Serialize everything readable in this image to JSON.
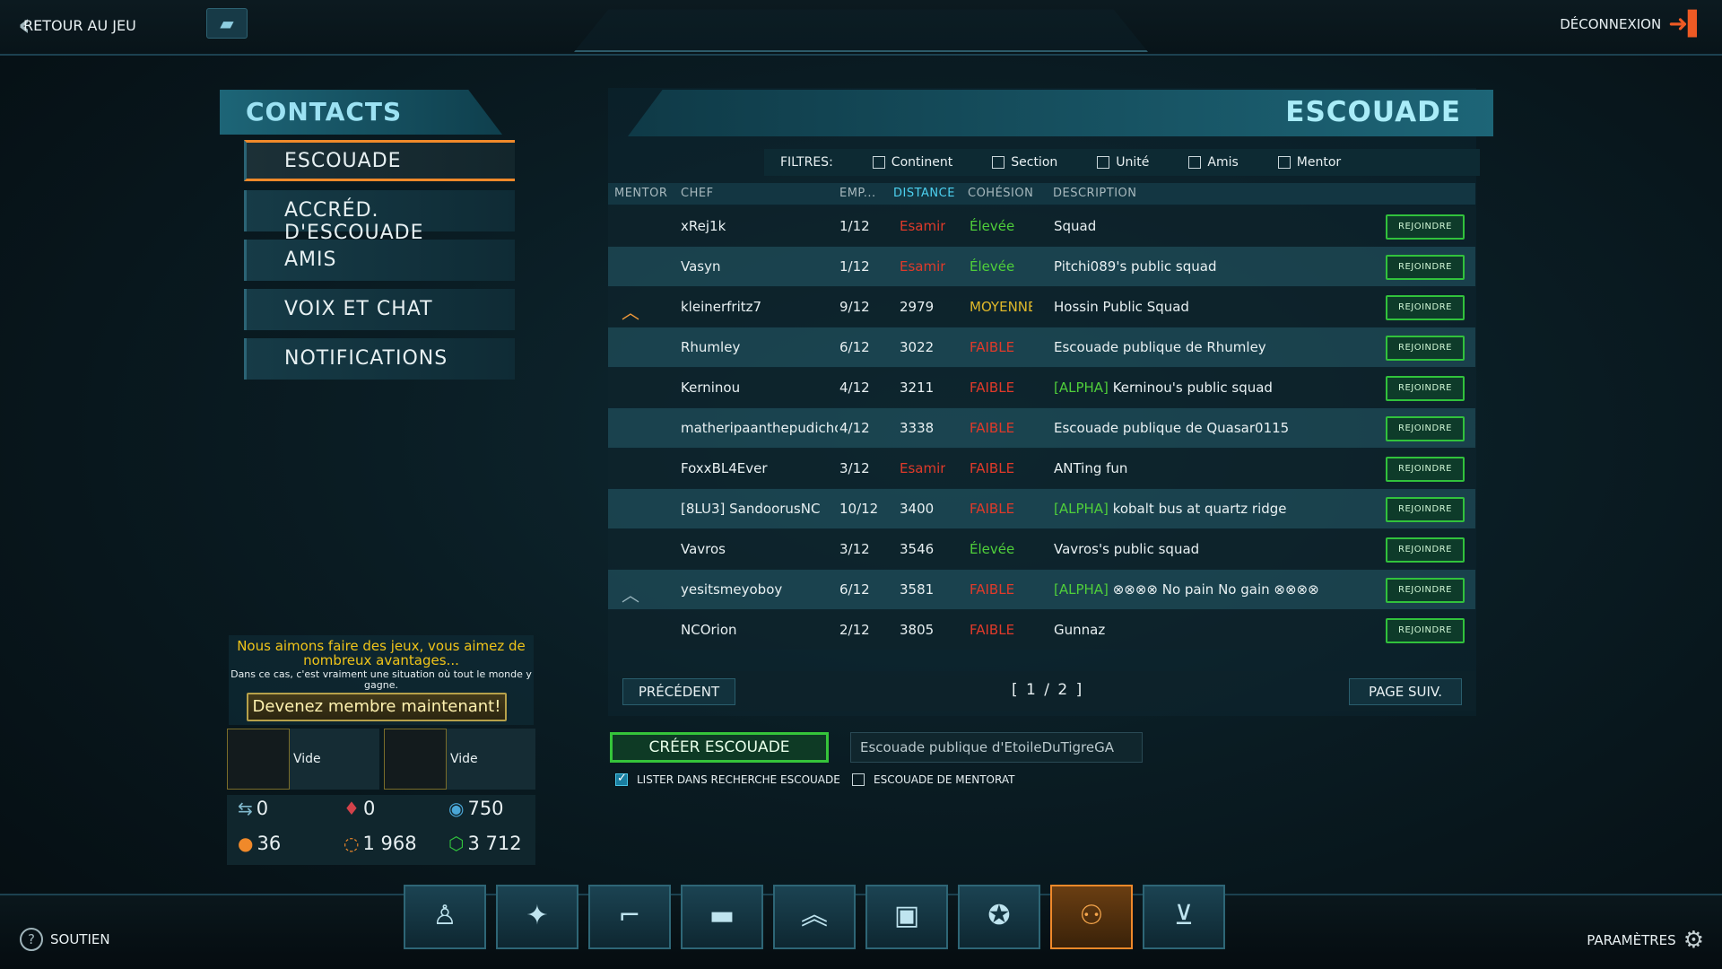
{
  "topbar": {
    "back_label": "RETOUR AU JEU",
    "logout_label": "DÉCONNEXION"
  },
  "sidebar": {
    "title": "CONTACTS",
    "items": [
      {
        "label": "ESCOUADE",
        "active": true
      },
      {
        "label": "ACCRÉD. D'ESCOUADE"
      },
      {
        "label": "AMIS"
      },
      {
        "label": "VOIX ET CHAT"
      },
      {
        "label": "NOTIFICATIONS"
      }
    ],
    "promo": {
      "headline": "Nous aimons faire des jeux, vous aimez de nombreux avantages...",
      "subtext": "Dans ce cas, c'est vraiment une situation où tout le monde y gagne.",
      "button": "Devenez membre maintenant!"
    },
    "slots": [
      {
        "label": "Vide"
      },
      {
        "label": "Vide"
      }
    ],
    "stats": {
      "s1": "0",
      "s2": "0",
      "s3": "750",
      "s4": "36",
      "s5": "1 968",
      "s6": "3 712"
    }
  },
  "main": {
    "title": "ESCOUADE",
    "filters": {
      "label": "FILTRES:",
      "items": [
        {
          "label": "Continent",
          "checked": false
        },
        {
          "label": "Section",
          "checked": false
        },
        {
          "label": "Unité",
          "checked": false
        },
        {
          "label": "Amis",
          "checked": false
        },
        {
          "label": "Mentor",
          "checked": false
        }
      ]
    },
    "columns": {
      "mentor": "MENTOR",
      "chef": "CHEF",
      "emp": "EMP...",
      "distance": "DISTANCE",
      "cohesion": "COHÉSION",
      "description": "DESCRIPTION"
    },
    "join_label": "REJOINDRE",
    "rows": [
      {
        "mentor": "",
        "chef": "xRej1k",
        "emp": "1/12",
        "distance": "Esamir",
        "cohesion": "Élevée",
        "tag": "",
        "desc": "Squad"
      },
      {
        "mentor": "",
        "chef": "Vasyn",
        "emp": "1/12",
        "distance": "Esamir",
        "cohesion": "Élevée",
        "tag": "",
        "desc": "Pitchi089's public squad"
      },
      {
        "mentor": "up-chevron",
        "chef": "kleinerfritz7",
        "emp": "9/12",
        "distance": "2979",
        "cohesion": "MOYENNE",
        "tag": "",
        "desc": "Hossin Public Squad"
      },
      {
        "mentor": "",
        "chef": "Rhumley",
        "emp": "6/12",
        "distance": "3022",
        "cohesion": "FAIBLE",
        "tag": "",
        "desc": "Escouade publique de Rhumley"
      },
      {
        "mentor": "",
        "chef": "Kerninou",
        "emp": "4/12",
        "distance": "3211",
        "cohesion": "FAIBLE",
        "tag": "[ALPHA]",
        "desc": "Kerninou's public squad"
      },
      {
        "mentor": "",
        "chef": "matheripaanthepudicho",
        "emp": "4/12",
        "distance": "3338",
        "cohesion": "FAIBLE",
        "tag": "",
        "desc": "Escouade publique de Quasar0115"
      },
      {
        "mentor": "",
        "chef": "FoxxBL4Ever",
        "emp": "3/12",
        "distance": "Esamir",
        "cohesion": "FAIBLE",
        "tag": "",
        "desc": "ANTing fun"
      },
      {
        "mentor": "",
        "chef": "[8LU3] SandoorusNC",
        "emp": "10/12",
        "distance": "3400",
        "cohesion": "FAIBLE",
        "tag": "[ALPHA]",
        "desc": "kobalt bus at quartz ridge"
      },
      {
        "mentor": "",
        "chef": "Vavros",
        "emp": "3/12",
        "distance": "3546",
        "cohesion": "Élevée",
        "tag": "",
        "desc": "Vavros's public squad"
      },
      {
        "mentor": "up-chevron",
        "chef": "yesitsmeyoboy",
        "emp": "6/12",
        "distance": "3581",
        "cohesion": "FAIBLE",
        "tag": "[ALPHA]",
        "desc": "⊗⊗⊗⊗  No pain No gain ⊗⊗⊗⊗"
      },
      {
        "mentor": "",
        "chef": "NCOrion",
        "emp": "2/12",
        "distance": "3805",
        "cohesion": "FAIBLE",
        "tag": "",
        "desc": "Gunnaz"
      }
    ],
    "pager": {
      "prev": "PRÉCÉDENT",
      "indicator": "[ 1 / 2 ]",
      "next": "PAGE SUIV."
    },
    "create": {
      "button": "CRÉER ESCOUADE",
      "name_value": "Escouade publique d'EtoileDuTigreGA",
      "opt_list": "LISTER DANS RECHERCHE ESCOUADE",
      "opt_list_checked": true,
      "opt_mentor": "ESCOUADE DE MENTORAT",
      "opt_mentor_checked": false
    }
  },
  "dock": {
    "items": [
      {
        "icon": "soldier-icon"
      },
      {
        "icon": "compass-star-icon"
      },
      {
        "icon": "pistol-icon"
      },
      {
        "icon": "tank-icon"
      },
      {
        "icon": "rank-chevron-icon"
      },
      {
        "icon": "certification-icon"
      },
      {
        "icon": "medal-icon"
      },
      {
        "icon": "squad-icon",
        "active": true
      },
      {
        "icon": "cart-icon"
      }
    ]
  },
  "bottombar": {
    "support_label": "SOUTIEN",
    "settings_label": "PARAMÈTRES"
  },
  "colors": {
    "accent": "#f0892a",
    "join_green": "#31c23c",
    "cyan_title": "#a9ecf8",
    "low_red": "#e03a2a",
    "high_green": "#4fcf3a",
    "mid_yellow": "#e0b82a"
  }
}
